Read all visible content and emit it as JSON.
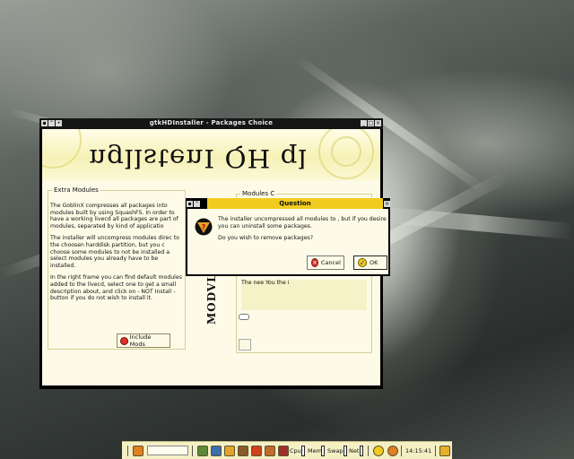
{
  "main_window": {
    "title": "gtkHDInstaller - Packages Choice",
    "banner_text": "ngllstenI QH ql",
    "extra_modules": {
      "label": "Extra Modules",
      "paragraphs": [
        "The GoblinX compresses all packages into modules built by using SquashFS. In order to have a working livecd all packages are part of modules, separated by kind of applicatio",
        "The installer will uncompress modules direc to the choosen harddisk partition, but you c choose some modules to not be installed a select modules you already have to be installed.",
        "In the right frame you can find default modules added to the livecd, select one to get a small description about, and click on - NOT Install - button if you do not wish to install it."
      ],
      "include_button": "Include Mods"
    },
    "modules_frame_label": "Modules C",
    "side_label": "MODVL",
    "right_text": "The nee You the i"
  },
  "question_dialog": {
    "title": "Question",
    "message_line1": "The installer uncompressed all modules to , but if you desire you can uninstall some packages.",
    "message_line2": "Do you wish to remove packages?",
    "cancel_label": "Cancel",
    "ok_label": "OK"
  },
  "panel": {
    "cpu_label": "Cpu",
    "mem_label": "Mem",
    "swap_label": "Swap",
    "net_label": "Net",
    "clock": "14:15:41"
  },
  "colors": {
    "accent_yellow": "#f1cc1f",
    "dialog_bg": "#fdfbe8",
    "panel_bg": "#f5f0c4"
  }
}
